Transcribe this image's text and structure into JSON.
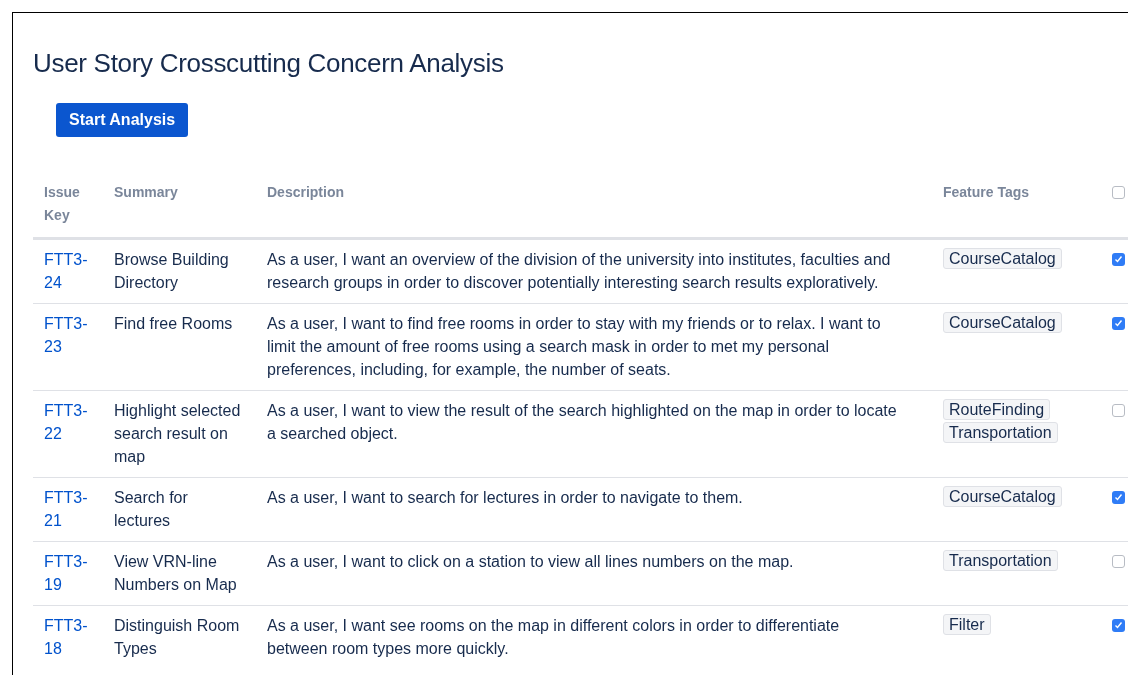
{
  "title": "User Story Crosscutting Concern Analysis",
  "start_button": "Start Analysis",
  "table": {
    "columns": [
      "Issue Key",
      "Summary",
      "Description",
      "Feature Tags"
    ],
    "select_all": {
      "checked": false
    },
    "rows": [
      {
        "key": "FTT3-24",
        "summary": "Browse Building Directory",
        "description": "As a user, I want an overview of the division of the university into institutes, faculties and research groups in order to discover potentially interesting search results exploratively.",
        "tags": [
          "CourseCatalog"
        ],
        "checked": true
      },
      {
        "key": "FTT3-23",
        "summary": "Find free Rooms",
        "description": "As a user, I want to find free rooms in order to stay with my friends or to relax. I want to limit the amount of free rooms using a search mask in order to met my personal preferences, including, for example, the number of seats.",
        "tags": [
          "CourseCatalog"
        ],
        "checked": true
      },
      {
        "key": "FTT3-22",
        "summary": "Highlight selected search result on map",
        "description": "As a user, I want to view the result of the search highlighted on the map in order to locate a searched object.",
        "tags": [
          "RouteFinding",
          "Transportation"
        ],
        "checked": false
      },
      {
        "key": "FTT3-21",
        "summary": "Search for lectures",
        "description": "As a user, I want to search for lectures in order to navigate to them.",
        "tags": [
          "CourseCatalog"
        ],
        "checked": true
      },
      {
        "key": "FTT3-19",
        "summary": "View VRN-line Numbers on Map",
        "description": "As a user, I want to click on a station to view all lines numbers on the map.",
        "tags": [
          "Transportation"
        ],
        "checked": false
      },
      {
        "key": "FTT3-18",
        "summary": "Distinguish Room Types",
        "description": "As a user, I want see rooms on the map in different colors in order to differentiate between room types more quickly.",
        "tags": [
          "Filter"
        ],
        "checked": true
      }
    ]
  }
}
